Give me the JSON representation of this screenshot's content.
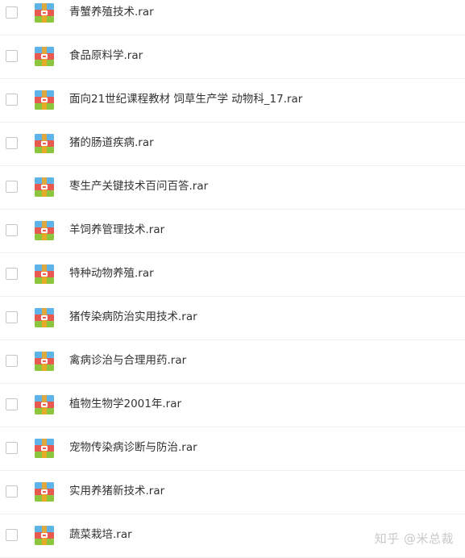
{
  "files": [
    {
      "name": "青蟹养殖技术.rar",
      "icon": "rar-archive-icon"
    },
    {
      "name": "食品原料学.rar",
      "icon": "rar-archive-icon"
    },
    {
      "name": "面向21世纪课程教材 饲草生产学 动物科_17.rar",
      "icon": "rar-archive-icon"
    },
    {
      "name": "猪的肠道疾病.rar",
      "icon": "rar-archive-icon"
    },
    {
      "name": "枣生产关键技术百问百答.rar",
      "icon": "rar-archive-icon"
    },
    {
      "name": "羊饲养管理技术.rar",
      "icon": "rar-archive-icon"
    },
    {
      "name": "特种动物养殖.rar",
      "icon": "rar-archive-icon"
    },
    {
      "name": "猪传染病防治实用技术.rar",
      "icon": "rar-archive-icon"
    },
    {
      "name": "禽病诊治与合理用药.rar",
      "icon": "rar-archive-icon"
    },
    {
      "name": "植物生物学2001年.rar",
      "icon": "rar-archive-icon"
    },
    {
      "name": "宠物传染病诊断与防治.rar",
      "icon": "rar-archive-icon"
    },
    {
      "name": "实用养猪新技术.rar",
      "icon": "rar-archive-icon"
    },
    {
      "name": "蔬菜栽培.rar",
      "icon": "rar-archive-icon"
    }
  ],
  "watermark": "知乎 @米总裁",
  "colors": {
    "text": "#333333",
    "checkbox_border": "#c6c6c6",
    "row_divider": "#efefef",
    "icon_top_blue": "#5eb3e8",
    "icon_middle_red": "#e85a4f",
    "icon_bottom_green": "#8cc63f",
    "icon_strap_orange": "#f5a623"
  }
}
